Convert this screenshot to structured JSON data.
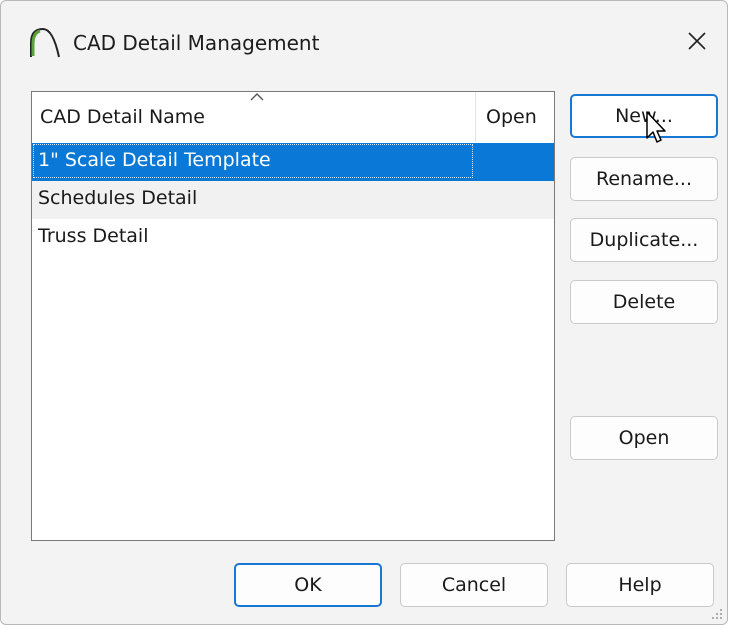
{
  "window": {
    "title": "CAD Detail Management",
    "icon": "chief-architect-arc-icon",
    "close_icon": "close-icon"
  },
  "list": {
    "columns": [
      "CAD Detail Name",
      "Open"
    ],
    "sort_indicator": "sort-ascending-caret-icon",
    "rows": [
      {
        "name": "1\" Scale Detail Template",
        "open": "",
        "selected": true
      },
      {
        "name": "Schedules Detail",
        "open": ""
      },
      {
        "name": "Truss Detail",
        "open": ""
      }
    ]
  },
  "side_buttons": {
    "new": "New...",
    "rename": "Rename...",
    "duplicate": "Duplicate...",
    "delete": "Delete",
    "open": "Open"
  },
  "footer_buttons": {
    "ok": "OK",
    "cancel": "Cancel",
    "help": "Help"
  },
  "colors": {
    "selection": "#0a78d6",
    "focus_border": "#1977d4",
    "dialog_bg": "#f3f3f3"
  }
}
